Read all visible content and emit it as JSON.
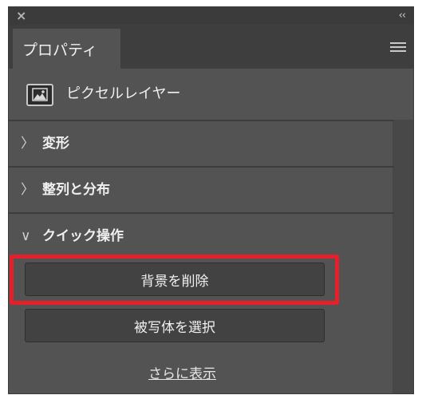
{
  "panel": {
    "close_symbol": "×",
    "collapse_symbol": "‹‹",
    "tab_label": "プロパティ",
    "menu_icon": "hamburger-menu-icon"
  },
  "layer_type": {
    "icon": "pixel-layer-icon",
    "label": "ピクセルレイヤー"
  },
  "sections": [
    {
      "label": "変形",
      "state": "collapsed"
    },
    {
      "label": "整列と分布",
      "state": "collapsed"
    },
    {
      "label": "クイック操作",
      "state": "expanded"
    }
  ],
  "chevrons": {
    "collapsed": "〉",
    "expanded": "∨"
  },
  "quick_actions": {
    "remove_background": "背景を削除",
    "select_subject": "被写体を選択",
    "show_more": "さらに表示"
  },
  "colors": {
    "panel_bg": "#535353",
    "highlight": "#e5202a",
    "button_bg": "#424242"
  }
}
